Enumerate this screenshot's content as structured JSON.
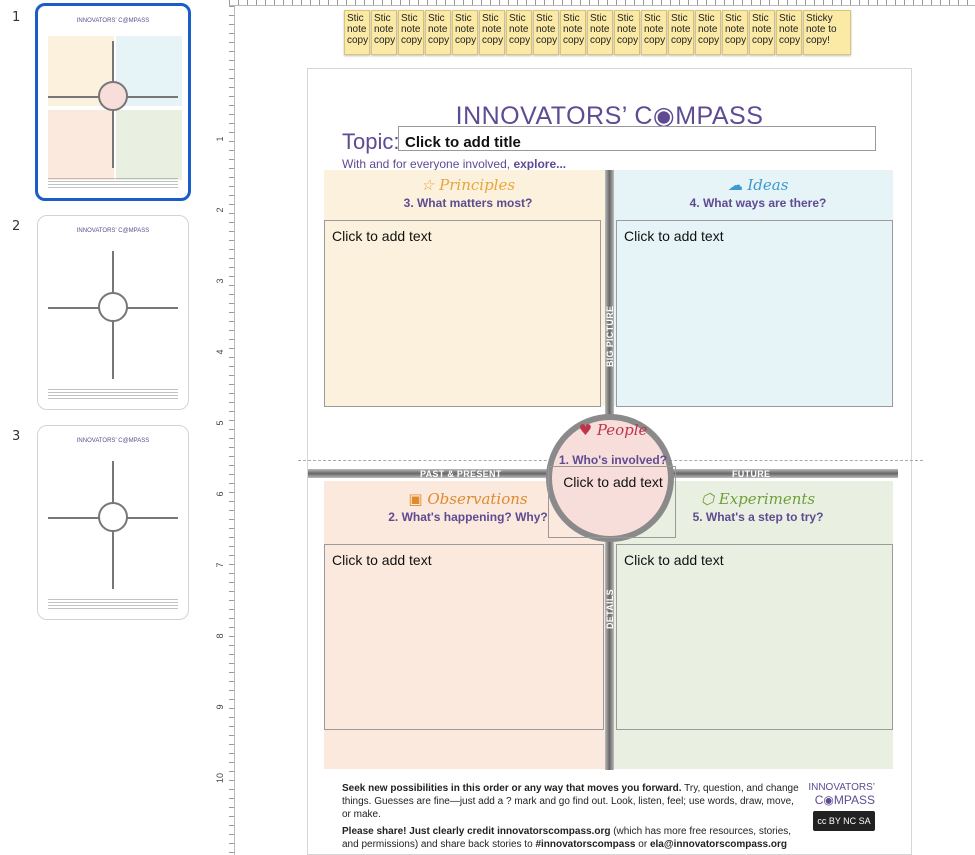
{
  "filmstrip": {
    "slides": [
      {
        "number": "1",
        "title": "INNOVATORS' C@MPASS"
      },
      {
        "number": "2",
        "title": "INNOVATORS' C@MPASS"
      },
      {
        "number": "3",
        "title": "INNOVATORS' C@MPASS"
      }
    ]
  },
  "ruler": {
    "marks": [
      "1",
      "2",
      "3",
      "4",
      "5",
      "6",
      "7",
      "8",
      "9",
      "10"
    ]
  },
  "stickies": [
    "Stic note copy",
    "Stic note copy",
    "Stic note copy",
    "Stic note copy",
    "Stic note copy",
    "Stic note copy",
    "Stic note copy",
    "Stic note copy",
    "Stic note copy",
    "Stic note copy",
    "Stic note copy",
    "Stic note copy",
    "Stic note copy",
    "Stic note copy",
    "Stic note copy",
    "Stic note copy",
    "Stic note copy",
    "Sticky note to copy!"
  ],
  "template": {
    "brand": "INNOVATORS’ C◉MPASS",
    "topic_label": "Topic:",
    "title_placeholder": "Click to add title",
    "with_line_prefix": "With and for everyone involved,",
    "with_line_bold": "explore...",
    "principles": {
      "name": "Principles",
      "question": "3. What matters most?",
      "text": "Click to add text"
    },
    "ideas": {
      "name": "Ideas",
      "question": "4. What ways are there?",
      "text": "Click to add text"
    },
    "people": {
      "name": "People",
      "question": "1. Who's involved?",
      "text": "Click to add text"
    },
    "observations": {
      "name": "Observations",
      "question": "2. What's happening? Why?",
      "text": "Click to add text"
    },
    "experiments": {
      "name": "Experiments",
      "question": "5. What's a step to try?",
      "text": "Click to add text"
    },
    "axes": {
      "big_picture": "BIG PICTURE",
      "past_present": "PAST & PRESENT",
      "future": "FUTURE",
      "details": "DETAILS"
    },
    "footer": {
      "line1_bold": "Seek new possibilities in this order or any way that moves you forward.",
      "line1_rest": " Try, question, and change things. Guesses are fine—just add a ? mark and go find out. Look, listen, feel; use words, draw, move, or make.",
      "line2_bold": "Please share! Just clearly credit innovatorscompass.org",
      "line2_rest": " (which has more free resources, stories, and permissions) and share back stories to ",
      "line2_tag": "#innovatorscompass",
      "line2_mid": " or ",
      "line2_email": "ela@innovatorscompass.org",
      "brand_top": "INNOVATORS’",
      "brand_bottom": "C◉MPASS",
      "license": "cc BY NC SA"
    }
  },
  "colors": {
    "brand_purple": "#5f4b92",
    "active_border": "#1a5cc8",
    "sticky": "#fbe9a6"
  }
}
